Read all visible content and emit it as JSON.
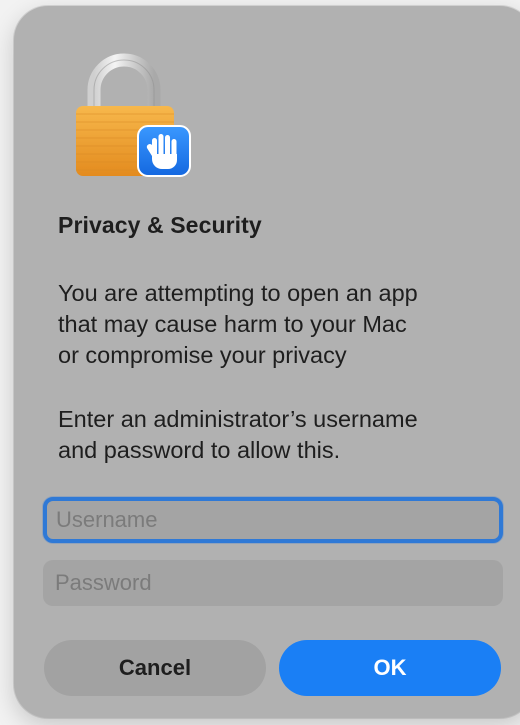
{
  "dialog": {
    "icon": "lock-with-hand-icon",
    "title": "Privacy & Security",
    "message_lines": [
      "You are attempting to open an app",
      "that may cause harm to your Mac",
      "or compromise your privacy"
    ],
    "instruction_lines": [
      "Enter an administrator’s username",
      "and password to allow this."
    ],
    "username_placeholder": "Username",
    "username_value": "",
    "password_placeholder": "Password",
    "password_value": "",
    "cancel_label": "Cancel",
    "ok_label": "OK"
  },
  "colors": {
    "dialog_background": "#b1b1b1",
    "field_background": "#a4a4a4",
    "focus_ring": "#2f79d6",
    "ok_button": "#1a7ff5",
    "cancel_button": "#a2a2a2",
    "lock_body": "#f3a73a",
    "badge": "#1a7ff5"
  }
}
